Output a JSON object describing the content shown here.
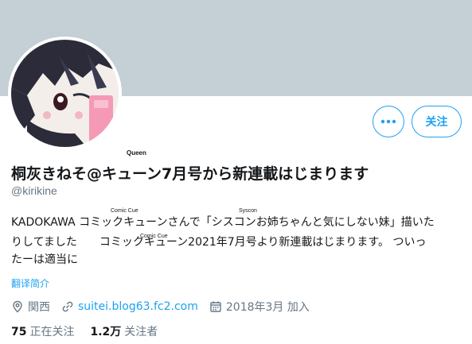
{
  "profile": {
    "display_name": "桐灰きねそ@キューン7月号から新連載はじまります",
    "name_ruby": "Queen",
    "handle": "@kirikine"
  },
  "actions": {
    "follow_label": "关注",
    "more_icon": "more-dots-icon"
  },
  "bio": {
    "line1": "KADOKAWA コミックキューンさんで「シスコンお姉ちゃんと気にしない妹」描いた",
    "line1_ruby_a": "Comic Cue",
    "line1_ruby_b": "Syscon",
    "line2": "りしてました　　コミックキューン2021年7月号より新連載はじまります。 ついっ",
    "line2_ruby": "Comic Cue",
    "line3": "たーは適当に"
  },
  "translate_label": "翻译简介",
  "meta": {
    "location": "関西",
    "website": "suitei.blog63.fc2.com",
    "joined": "2018年3月 加入"
  },
  "stats": {
    "following_count": "75",
    "following_label": "正在关注",
    "followers_count": "1.2万",
    "followers_label": "关注者"
  },
  "colors": {
    "banner": "#c4cfd6",
    "accent": "#1da1f2",
    "muted": "#657786"
  }
}
